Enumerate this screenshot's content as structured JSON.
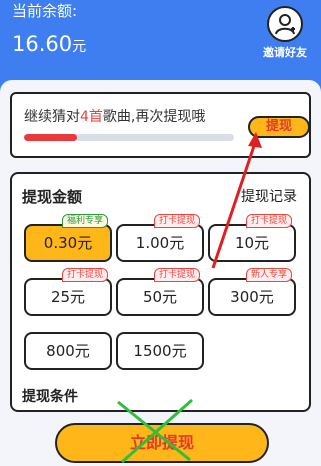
{
  "header": {
    "balance_label": "当前余额:",
    "balance_value": "16.60",
    "balance_unit": "元",
    "invite_label": "邀请好友",
    "invite_icon": "user-icon"
  },
  "task": {
    "text_prefix": "继续猜对",
    "text_highlight": "4首",
    "text_suffix": "歌曲,再次提现哦",
    "progress_fraction": 0.25,
    "withdraw_label": "提现"
  },
  "panel": {
    "title": "提现金额",
    "history_label": "提现记录",
    "amounts": [
      {
        "label": "0.30元",
        "tag": "福利专享",
        "selected": true
      },
      {
        "label": "1.00元",
        "tag": "打卡提现",
        "selected": false
      },
      {
        "label": "10元",
        "tag": "打卡提现",
        "selected": false
      },
      {
        "label": "25元",
        "tag": "打卡提现",
        "selected": false
      },
      {
        "label": "50元",
        "tag": "打卡提现",
        "selected": false
      },
      {
        "label": "300元",
        "tag": "新人专享",
        "selected": false
      },
      {
        "label": "800元",
        "tag": "",
        "selected": false
      },
      {
        "label": "1500元",
        "tag": "",
        "selected": false
      }
    ],
    "conditions_title": "提现条件"
  },
  "main_button": {
    "label": "立即提现"
  },
  "colors": {
    "primary_blue": "#3f7ef0",
    "accent_yellow": "#ffb619",
    "accent_red": "#e23a2a"
  }
}
